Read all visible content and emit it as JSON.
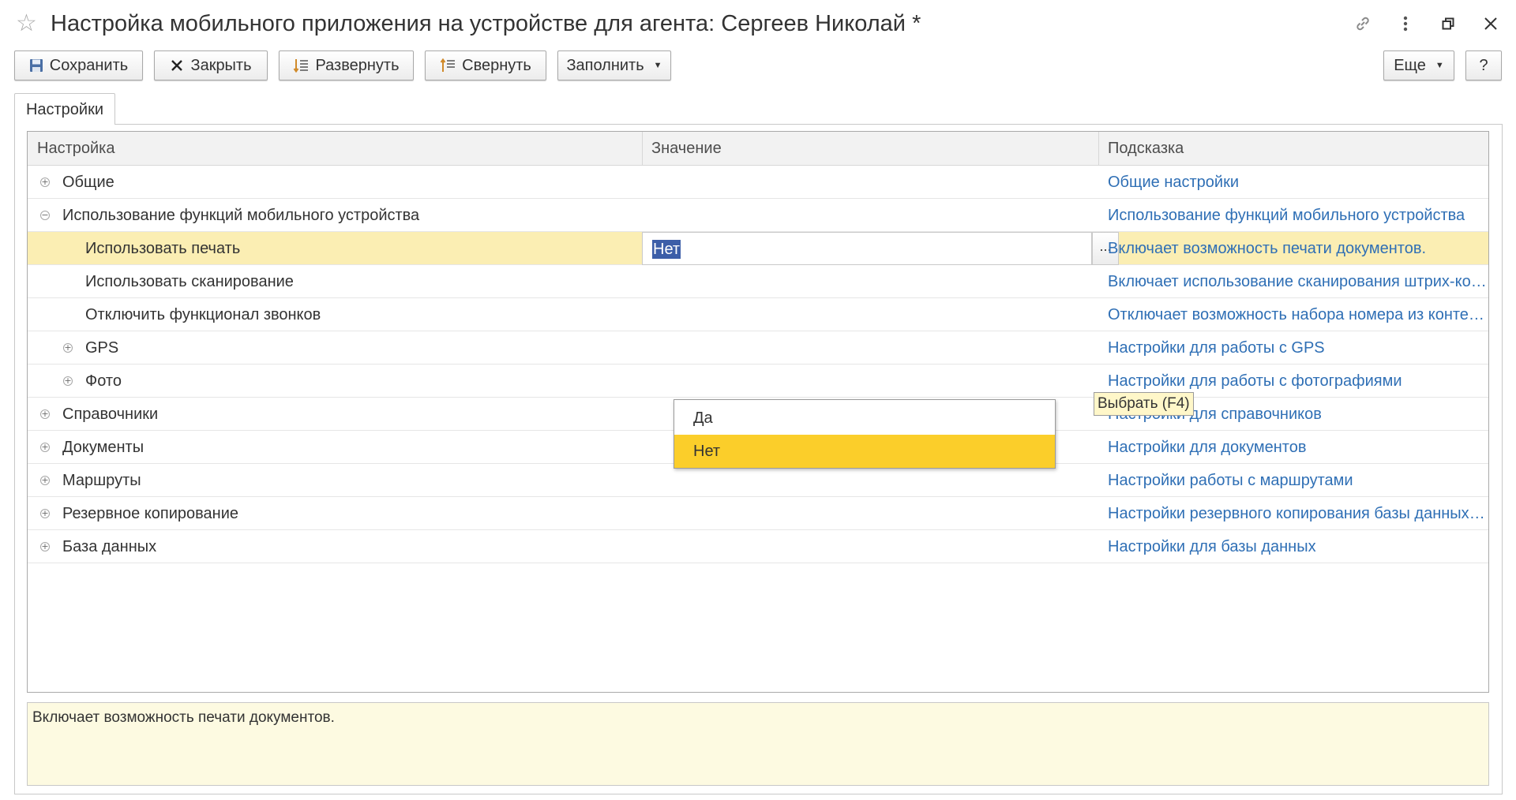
{
  "window": {
    "title": "Настройка мобильного приложения на устройстве для агента: Сергеев Николай *"
  },
  "toolbar": {
    "save": "Сохранить",
    "close": "Закрыть",
    "expand": "Развернуть",
    "collapse": "Свернуть",
    "fill": "Заполнить",
    "more": "Еще",
    "help": "?"
  },
  "tabs": [
    "Настройки"
  ],
  "table": {
    "columns": [
      "Настройка",
      "Значение",
      "Подсказка"
    ],
    "rows": [
      {
        "level": 0,
        "tree": "plus",
        "name": "Общие",
        "value": "",
        "hint": "Общие настройки"
      },
      {
        "level": 0,
        "tree": "minus",
        "name": "Использование функций мобильного устройства",
        "value": "",
        "hint": "Использование функций мобильного устройства"
      },
      {
        "level": 1,
        "tree": "none",
        "name": "Использовать печать",
        "value": "Нет",
        "hint": "Включает возможность печати документов.",
        "selected": true
      },
      {
        "level": 1,
        "tree": "none",
        "name": "Использовать сканирование",
        "value": "",
        "hint": "Включает использование сканирования штрих-ко…"
      },
      {
        "level": 1,
        "tree": "none",
        "name": "Отключить функционал звонков",
        "value": "",
        "hint": "Отключает возможность набора номера из конте…"
      },
      {
        "level": 1,
        "tree": "plus",
        "name": "GPS",
        "value": "",
        "hint": "Настройки для работы с GPS"
      },
      {
        "level": 1,
        "tree": "plus",
        "name": "Фото",
        "value": "",
        "hint": "Настройки для работы с фотографиями"
      },
      {
        "level": 0,
        "tree": "plus",
        "name": "Справочники",
        "value": "",
        "hint": "Настройки для справочников"
      },
      {
        "level": 0,
        "tree": "plus",
        "name": "Документы",
        "value": "",
        "hint": "Настройки для документов"
      },
      {
        "level": 0,
        "tree": "plus",
        "name": "Маршруты",
        "value": "",
        "hint": "Настройки работы с маршрутами"
      },
      {
        "level": 0,
        "tree": "plus",
        "name": "Резервное копирование",
        "value": "",
        "hint": "Настройки резервного копирования базы данных …"
      },
      {
        "level": 0,
        "tree": "plus",
        "name": "База данных",
        "value": "",
        "hint": "Настройки для базы данных"
      }
    ]
  },
  "editor": {
    "select_button": "...",
    "tooltip": "Выбрать (F4)",
    "options": [
      "Да",
      "Нет"
    ],
    "active_option": "Нет"
  },
  "hint_panel": {
    "text": "Включает возможность печати документов."
  },
  "colors": {
    "link": "#2f6fb5",
    "selected_row": "#fbeeb3",
    "dropdown_active": "#fbce2a",
    "hint_bg": "#fdfae1",
    "selection_text_bg": "#3c5ea8"
  }
}
